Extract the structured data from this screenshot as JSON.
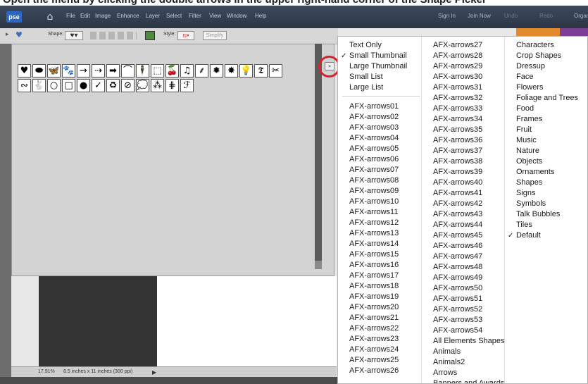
{
  "caption": "Open the menu by clicking the double arrows in the upper right-hand corner of the Shape Picker",
  "app": {
    "logo": "pse",
    "menu": [
      "File",
      "Edit",
      "Image",
      "Enhance",
      "Layer",
      "Select",
      "Filter",
      "View",
      "Window",
      "Help"
    ],
    "right_items": [
      "Sign In",
      "Join Now",
      "Undo",
      "Redo",
      "Organizer"
    ]
  },
  "options_bar": {
    "shape_label": "Shape:",
    "style_label": "Style:",
    "simplify_label": "Simplify"
  },
  "picker": {
    "more_label": "»",
    "row1": [
      "♥",
      "⬬",
      "🦋",
      "🐾",
      "→",
      "⇢",
      "➡",
      "⌒",
      "🕴",
      "⬚",
      "🍒",
      "♫",
      "⸙",
      "✹",
      "✸",
      "💡",
      "𝕿",
      "✂"
    ],
    "row2": [
      "∾",
      "🐇",
      "○",
      "□",
      "●",
      "✓",
      "♻",
      "⊘",
      "💭",
      "⁂",
      "⋕",
      "ℱ"
    ]
  },
  "status": {
    "zoom": "17.91%",
    "doc_info": "8.5 inches x 11 inches (300 ppi)"
  },
  "context_menu": {
    "view_options": [
      "Text Only",
      "Small Thumbnail",
      "Large Thumbnail",
      "Small List",
      "Large List"
    ],
    "view_checked": "Small Thumbnail",
    "col1": [
      "AFX-arrows01",
      "AFX-arrows02",
      "AFX-arrows03",
      "AFX-arrows04",
      "AFX-arrows05",
      "AFX-arrows06",
      "AFX-arrows07",
      "AFX-arrows08",
      "AFX-arrows09",
      "AFX-arrows10",
      "AFX-arrows11",
      "AFX-arrows12",
      "AFX-arrows13",
      "AFX-arrows14",
      "AFX-arrows15",
      "AFX-arrows16",
      "AFX-arrows17",
      "AFX-arrows18",
      "AFX-arrows19",
      "AFX-arrows20",
      "AFX-arrows21",
      "AFX-arrows22",
      "AFX-arrows23",
      "AFX-arrows24",
      "AFX-arrows25",
      "AFX-arrows26"
    ],
    "col2": [
      "AFX-arrows27",
      "AFX-arrows28",
      "AFX-arrows29",
      "AFX-arrows30",
      "AFX-arrows31",
      "AFX-arrows32",
      "AFX-arrows33",
      "AFX-arrows34",
      "AFX-arrows35",
      "AFX-arrows36",
      "AFX-arrows37",
      "AFX-arrows38",
      "AFX-arrows39",
      "AFX-arrows40",
      "AFX-arrows41",
      "AFX-arrows42",
      "AFX-arrows43",
      "AFX-arrows44",
      "AFX-arrows45",
      "AFX-arrows46",
      "AFX-arrows47",
      "AFX-arrows48",
      "AFX-arrows49",
      "AFX-arrows50",
      "AFX-arrows51",
      "AFX-arrows52",
      "AFX-arrows53",
      "AFX-arrows54",
      "All Elements Shapes",
      "Animals",
      "Animals2",
      "Arrows",
      "Banners and Awards"
    ],
    "col3": [
      "Characters",
      "Crop Shapes",
      "Dressup",
      "Face",
      "Flowers",
      "Foliage and Trees",
      "Food",
      "Frames",
      "Fruit",
      "Music",
      "Nature",
      "Objects",
      "Ornaments",
      "Shapes",
      "Signs",
      "Symbols",
      "Talk Bubbles",
      "Tiles",
      "Default"
    ],
    "col3_checked": "Default"
  },
  "colors": {
    "highlight": "#d1262f",
    "menubar": "#2c3645",
    "foreground_swatch": "#4e8a3e"
  }
}
